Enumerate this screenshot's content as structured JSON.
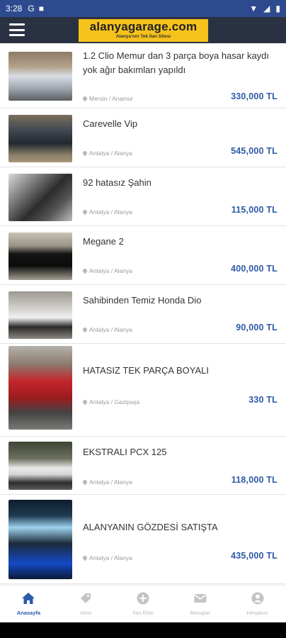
{
  "status": {
    "time": "3:28",
    "left_icons": [
      "G",
      "■"
    ],
    "right_icons": [
      "▼",
      "◢",
      "▮"
    ]
  },
  "header": {
    "brand": "alanyagarage.com",
    "tagline": "Alanya'nın Tek İlan Sitesi"
  },
  "listings": [
    {
      "title": "1.2 Clio Memur dan 3 parça boya hasar kaydı yok ağır bakımları yapıldı",
      "location": "Mersin / Anamur",
      "price": "330,000 TL"
    },
    {
      "title": "Carevelle Vip",
      "location": "Antalya / Alanya",
      "price": "545,000 TL"
    },
    {
      "title": "92 hatasız Şahin",
      "location": "Antalya / Alanya",
      "price": "115,000 TL"
    },
    {
      "title": "Megane 2",
      "location": "Antalya / Alanya",
      "price": "400,000 TL"
    },
    {
      "title": "Sahibinden Temiz Honda Dio",
      "location": "Antalya / Alanya",
      "price": "90,000 TL"
    },
    {
      "title": "HATASIZ TEK PARÇA BOYALI",
      "location": "Antalya / Gazipaşa",
      "price": "330 TL"
    },
    {
      "title": "EKSTRALI PCX 125",
      "location": "Antalya / Alanya",
      "price": "118,000 TL"
    },
    {
      "title": "ALANYANIN GÖZDESİ SATIŞTA",
      "location": "Antalya / Alanya",
      "price": "435,000 TL"
    }
  ],
  "nav": [
    {
      "label": "Anasayfa",
      "icon": "home-icon",
      "active": true
    },
    {
      "label": "Vitrin",
      "icon": "tag-icon",
      "active": false
    },
    {
      "label": "İlan Ekle",
      "icon": "add-circle-icon",
      "active": false
    },
    {
      "label": "Mesajlar",
      "icon": "mail-icon",
      "active": false
    },
    {
      "label": "Hesabım",
      "icon": "account-icon",
      "active": false
    }
  ],
  "colors": {
    "accent": "#2e5aa8",
    "header": "#2a3142",
    "logo_bg": "#f6c21c",
    "status_bar": "#2e4a8f"
  }
}
